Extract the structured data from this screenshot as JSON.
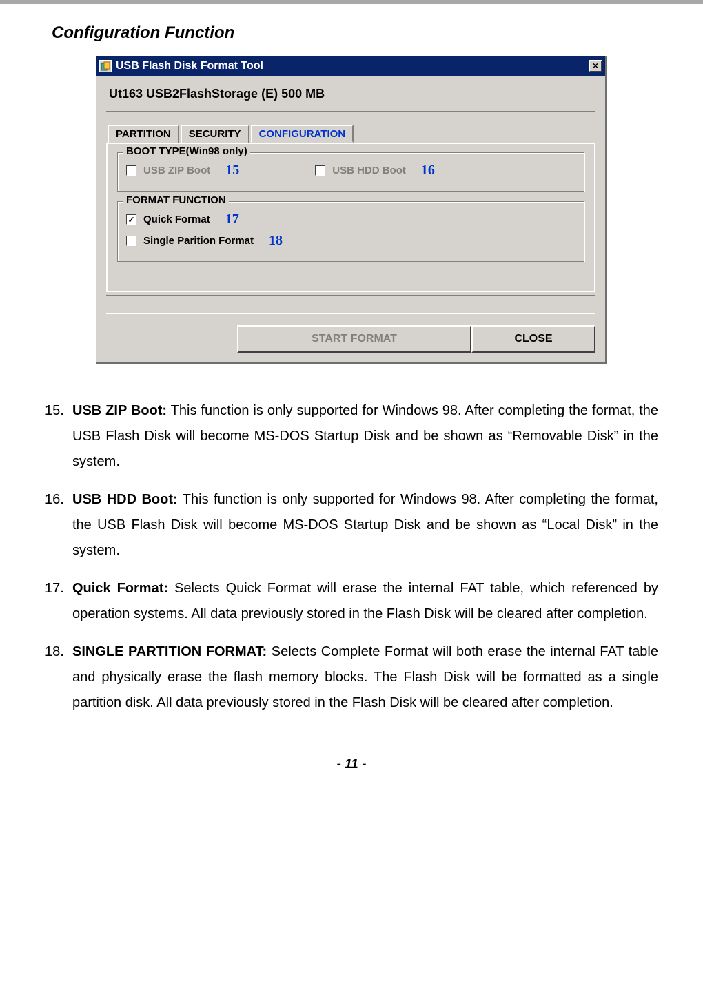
{
  "section_title": "Configuration Function",
  "window": {
    "title": "USB Flash Disk Format Tool",
    "close_glyph": "×",
    "device_line": "Ut163    USB2FlashStorage (E)  500 MB",
    "tabs": {
      "partition": "PARTITION",
      "security": "SECURITY",
      "configuration": "CONFIGURATION"
    },
    "groups": {
      "boot": {
        "legend": "BOOT TYPE(Win98 only)",
        "zip_label": "USB ZIP Boot",
        "hdd_label": "USB HDD Boot"
      },
      "format": {
        "legend": "FORMAT FUNCTION",
        "quick_label": "Quick Format",
        "single_label": "Single Parition Format"
      }
    },
    "callouts": {
      "n15": "15",
      "n16": "16",
      "n17": "17",
      "n18": "18"
    },
    "buttons": {
      "start": "START FORMAT",
      "close": "CLOSE"
    }
  },
  "list": {
    "i15": {
      "term": "USB ZIP Boot:",
      "body": " This function is only supported for Windows 98. After completing the format, the USB Flash Disk will become MS-DOS Startup Disk and be shown as “Removable Disk” in the system."
    },
    "i16": {
      "term": "USB HDD Boot:",
      "body": " This function is only supported for Windows 98. After completing the format, the USB Flash Disk will become MS-DOS Startup Disk and be shown as “Local Disk” in the system."
    },
    "i17": {
      "term": "Quick Format:",
      "body": " Selects Quick Format will erase the internal FAT table, which referenced by operation systems. All data previously stored in the Flash Disk will be cleared after completion."
    },
    "i18": {
      "term": "SINGLE PARTITION FORMAT:",
      "body": "  Selects Complete Format will both erase the internal FAT table and physically erase the flash memory blocks. The Flash Disk will be formatted as a single partition disk. All data previously stored in the Flash Disk will be cleared after completion."
    }
  },
  "footer": "- 11 -"
}
